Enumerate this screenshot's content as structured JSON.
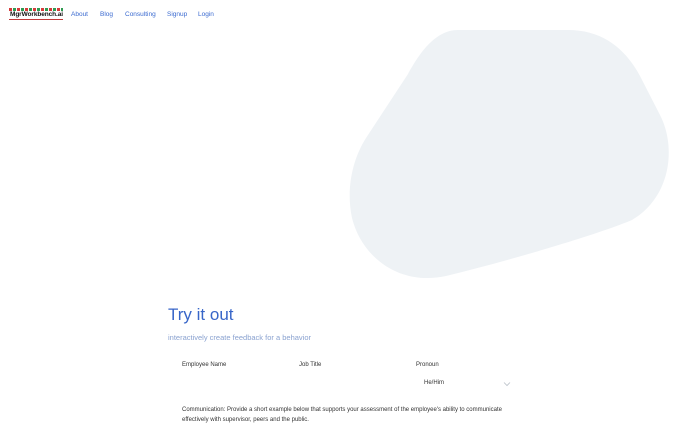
{
  "nav": {
    "logo_text": "MgrWorkbench.ai",
    "links": [
      "About",
      "Blog",
      "Consulting",
      "Signup",
      "Login"
    ]
  },
  "hero": {
    "blob_color": "#eef2f5"
  },
  "try_it": {
    "title": "Try it out",
    "subtitle": "interactively create feedback for a behavior"
  },
  "form": {
    "employee_name_label": "Employee Name",
    "job_title_label": "Job Title",
    "pronoun_label": "Pronoun",
    "pronoun_value": "He/Him"
  },
  "prompt": {
    "text": "Communication: Provide a short example below that supports your assessment of the employee's ability to communicate effectively with supervisor, peers and the public."
  },
  "colors": {
    "accent": "#3866c8",
    "subtitle": "#8aa2d0",
    "logo_red": "#d63a3a",
    "logo_green": "#2e9a50"
  }
}
